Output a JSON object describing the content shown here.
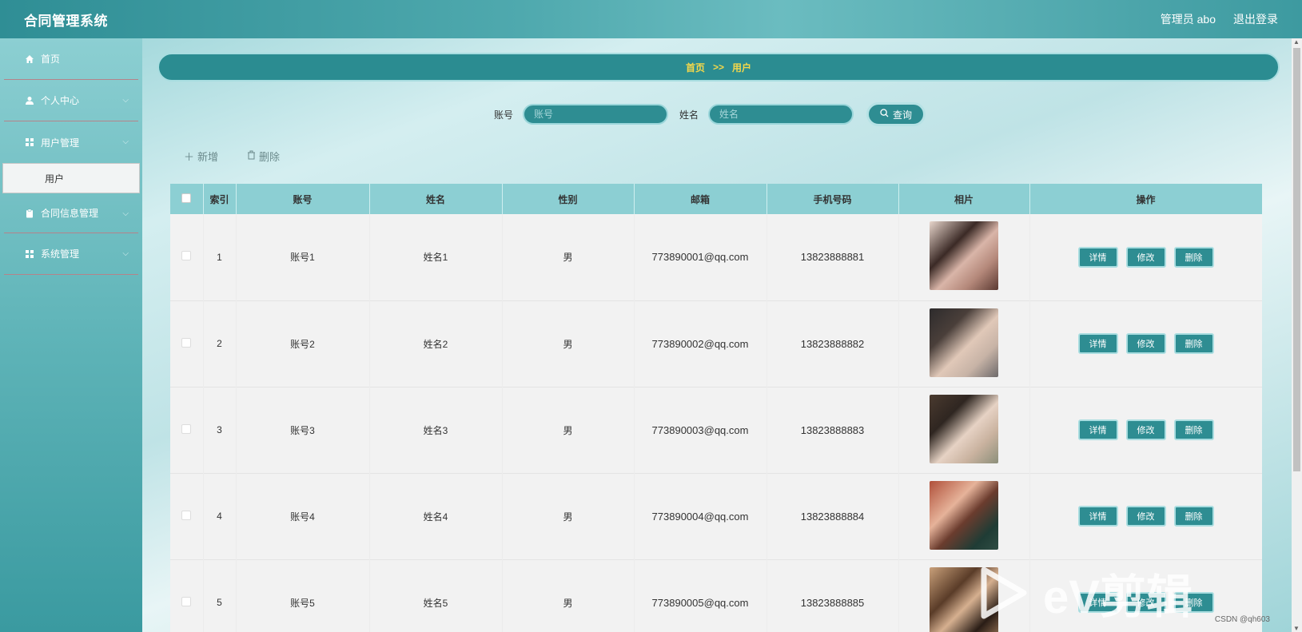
{
  "app": {
    "title": "合同管理系统"
  },
  "header": {
    "user": "管理员 abo",
    "logout": "退出登录"
  },
  "sidebar": {
    "items": [
      {
        "label": "首页",
        "icon": "home-icon"
      },
      {
        "label": "个人中心",
        "icon": "user-icon"
      },
      {
        "label": "用户管理",
        "icon": "grid-icon"
      },
      {
        "label": "合同信息管理",
        "icon": "clipboard-icon"
      },
      {
        "label": "系统管理",
        "icon": "grid-icon"
      }
    ],
    "submenu_user": "用户"
  },
  "breadcrumb": {
    "home": "首页",
    "sep": ">>",
    "current": "用户"
  },
  "search": {
    "account_label": "账号",
    "account_placeholder": "账号",
    "name_label": "姓名",
    "name_placeholder": "姓名",
    "button": "查询"
  },
  "actions": {
    "add": "新增",
    "delete": "删除"
  },
  "table": {
    "headers": [
      "索引",
      "账号",
      "姓名",
      "性别",
      "邮箱",
      "手机号码",
      "相片",
      "操作"
    ],
    "rows": [
      {
        "index": "1",
        "account": "账号1",
        "name": "姓名1",
        "gender": "男",
        "email": "773890001@qq.com",
        "phone": "13823888881"
      },
      {
        "index": "2",
        "account": "账号2",
        "name": "姓名2",
        "gender": "男",
        "email": "773890002@qq.com",
        "phone": "13823888882"
      },
      {
        "index": "3",
        "account": "账号3",
        "name": "姓名3",
        "gender": "男",
        "email": "773890003@qq.com",
        "phone": "13823888883"
      },
      {
        "index": "4",
        "account": "账号4",
        "name": "姓名4",
        "gender": "男",
        "email": "773890004@qq.com",
        "phone": "13823888884"
      },
      {
        "index": "5",
        "account": "账号5",
        "name": "姓名5",
        "gender": "男",
        "email": "773890005@qq.com",
        "phone": "13823888885"
      }
    ],
    "ops": {
      "detail": "详情",
      "edit": "修改",
      "delete": "删除"
    }
  },
  "watermark": "eV剪辑",
  "footer": "CSDN @qh603"
}
